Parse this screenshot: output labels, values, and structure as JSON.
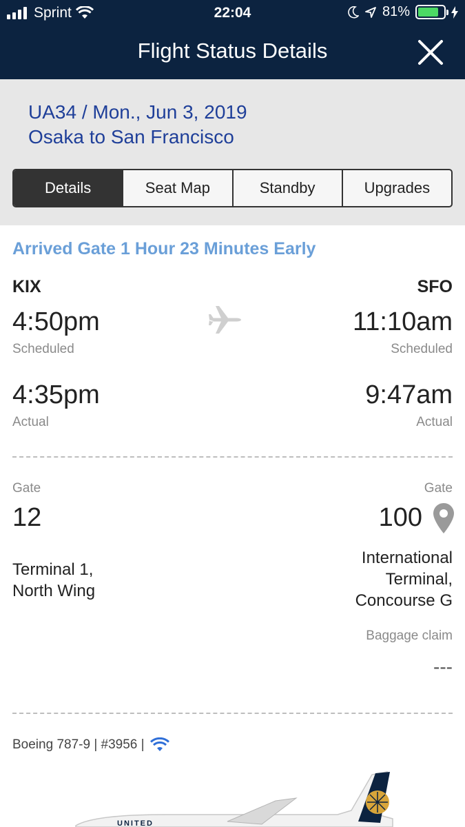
{
  "status_bar": {
    "carrier": "Sprint",
    "time": "22:04",
    "battery": "81%",
    "battery_level": 0.81
  },
  "header": {
    "title": "Flight Status Details",
    "close_icon": "close-icon"
  },
  "summary": {
    "flight": "UA34 / Mon., Jun 3, 2019",
    "route": "Osaka to San Francisco",
    "tabs": [
      {
        "label": "Details",
        "active": true
      },
      {
        "label": "Seat Map",
        "active": false
      },
      {
        "label": "Standby",
        "active": false
      },
      {
        "label": "Upgrades",
        "active": false
      }
    ]
  },
  "status": {
    "text": "Arrived Gate 1 Hour 23 Minutes Early",
    "color": "#6a9fd8"
  },
  "origin": {
    "code": "KIX",
    "scheduled_time": "4:50pm",
    "scheduled_label": "Scheduled",
    "actual_time": "4:35pm",
    "actual_label": "Actual",
    "gate_label": "Gate",
    "gate": "12",
    "terminal_line1": "Terminal 1,",
    "terminal_line2": "North Wing"
  },
  "destination": {
    "code": "SFO",
    "scheduled_time": "11:10am",
    "scheduled_label": "Scheduled",
    "actual_time": "9:47am",
    "actual_label": "Actual",
    "gate_label": "Gate",
    "gate": "100",
    "terminal_line1": "International",
    "terminal_line2": "Terminal,",
    "terminal_line3": "Concourse G",
    "baggage_label": "Baggage claim",
    "baggage_value": "---"
  },
  "aircraft": {
    "text": "Boeing 787-9 | #3956 |",
    "wifi_icon": "wifi-icon",
    "livery_text": "UNITED"
  },
  "colors": {
    "header_bg": "#0c2340",
    "link_blue": "#1f3f99",
    "status_blue": "#6a9fd8"
  }
}
